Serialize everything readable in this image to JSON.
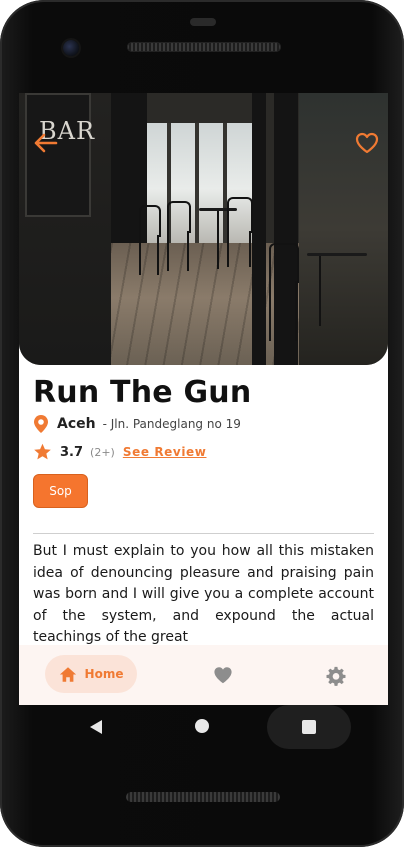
{
  "place": {
    "name": "Run The Gun",
    "city": "Aceh",
    "address": "- Jln. Pandeglang no 19",
    "rating": "3.7",
    "review_count": "(2+)",
    "see_review_label": "See Review",
    "tag_label": "Sop",
    "description": "But I must explain to you how all this mistaken idea of denouncing pleasure and praising pain was born and I will give you a complete account of the system, and expound the actual teachings of the great"
  },
  "hero": {
    "sign_text": "BAR"
  },
  "bottom_nav": {
    "home_label": "Home",
    "active_tab": "Home"
  },
  "colors": {
    "accent": "#f07a33",
    "button_bg": "#f5752e",
    "nav_bg": "#fdf5f2",
    "home_pill_bg": "#fbe3d8",
    "icon_gray": "#8d8d8d"
  },
  "icons": {
    "back": "arrow-left-icon",
    "favorite": "heart-outline-icon",
    "location": "location-pin-icon",
    "rating": "star-icon",
    "home": "home-icon",
    "favorites_tab": "heart-filled-icon",
    "settings": "gear-icon"
  }
}
